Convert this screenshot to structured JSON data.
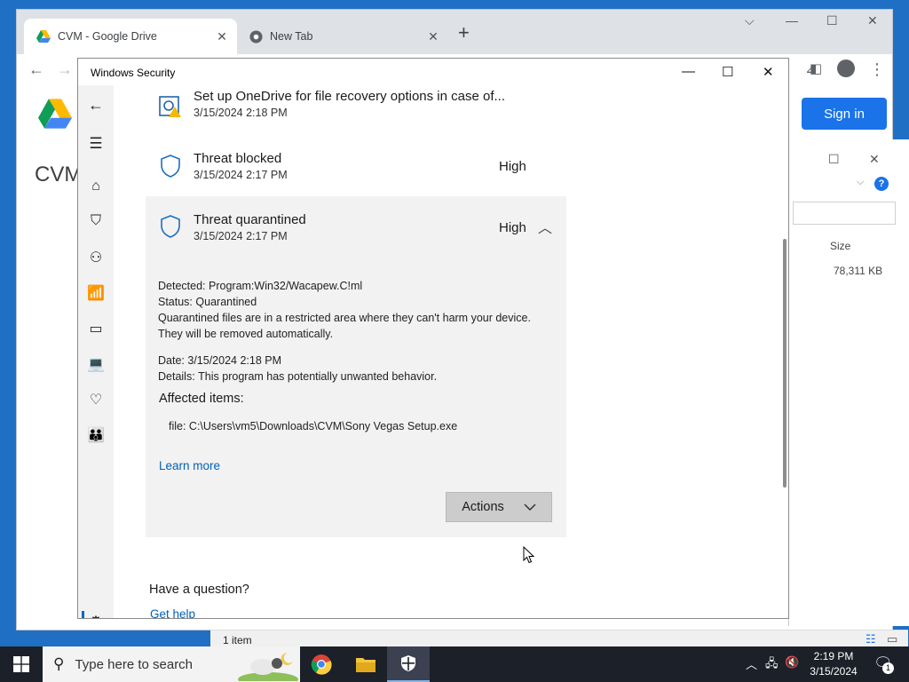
{
  "browser": {
    "tabs": [
      {
        "label": "CVM - Google Drive",
        "active": true
      },
      {
        "label": "New Tab",
        "active": false
      }
    ],
    "new_tab_glyph": "+"
  },
  "drive": {
    "page_title": "CVM",
    "signin_label": "Sign in"
  },
  "explorer": {
    "size_header": "Size",
    "file_size": "78,311 KB",
    "status": "1 item"
  },
  "security": {
    "window_title": "Windows Security",
    "entries": [
      {
        "title": "Set up OneDrive for file recovery options in case of...",
        "date": "3/15/2024 2:18 PM",
        "severity": ""
      },
      {
        "title": "Threat blocked",
        "date": "3/15/2024 2:17 PM",
        "severity": "High"
      },
      {
        "title": "Threat quarantined",
        "date": "3/15/2024 2:17 PM",
        "severity": "High"
      }
    ],
    "details": {
      "detected_label": "Detected:",
      "detected_value": "Program:Win32/Wacapew.C!ml",
      "status_label": "Status:",
      "status_value": "Quarantined",
      "note_line1": "Quarantined files are in a restricted area where they can't harm your device.",
      "note_line2": "They will be removed automatically.",
      "date_label": "Date:",
      "date_value": "3/15/2024 2:18 PM",
      "details_label": "Details:",
      "details_value": "This program has potentially unwanted behavior.",
      "affected_heading": "Affected items:",
      "affected_item": "file: C:\\Users\\vm5\\Downloads\\CVM\\Sony Vegas Setup.exe",
      "learn_more": "Learn more",
      "actions_label": "Actions"
    },
    "question": "Have a question?",
    "get_help": "Get help"
  },
  "taskbar": {
    "search_placeholder": "Type here to search",
    "time": "2:19 PM",
    "date": "3/15/2024",
    "notification_count": "1"
  },
  "colors": {
    "accent": "#0067c0",
    "link": "#0060b8",
    "signin": "#1a73e8",
    "taskbar": "#1b2029"
  }
}
